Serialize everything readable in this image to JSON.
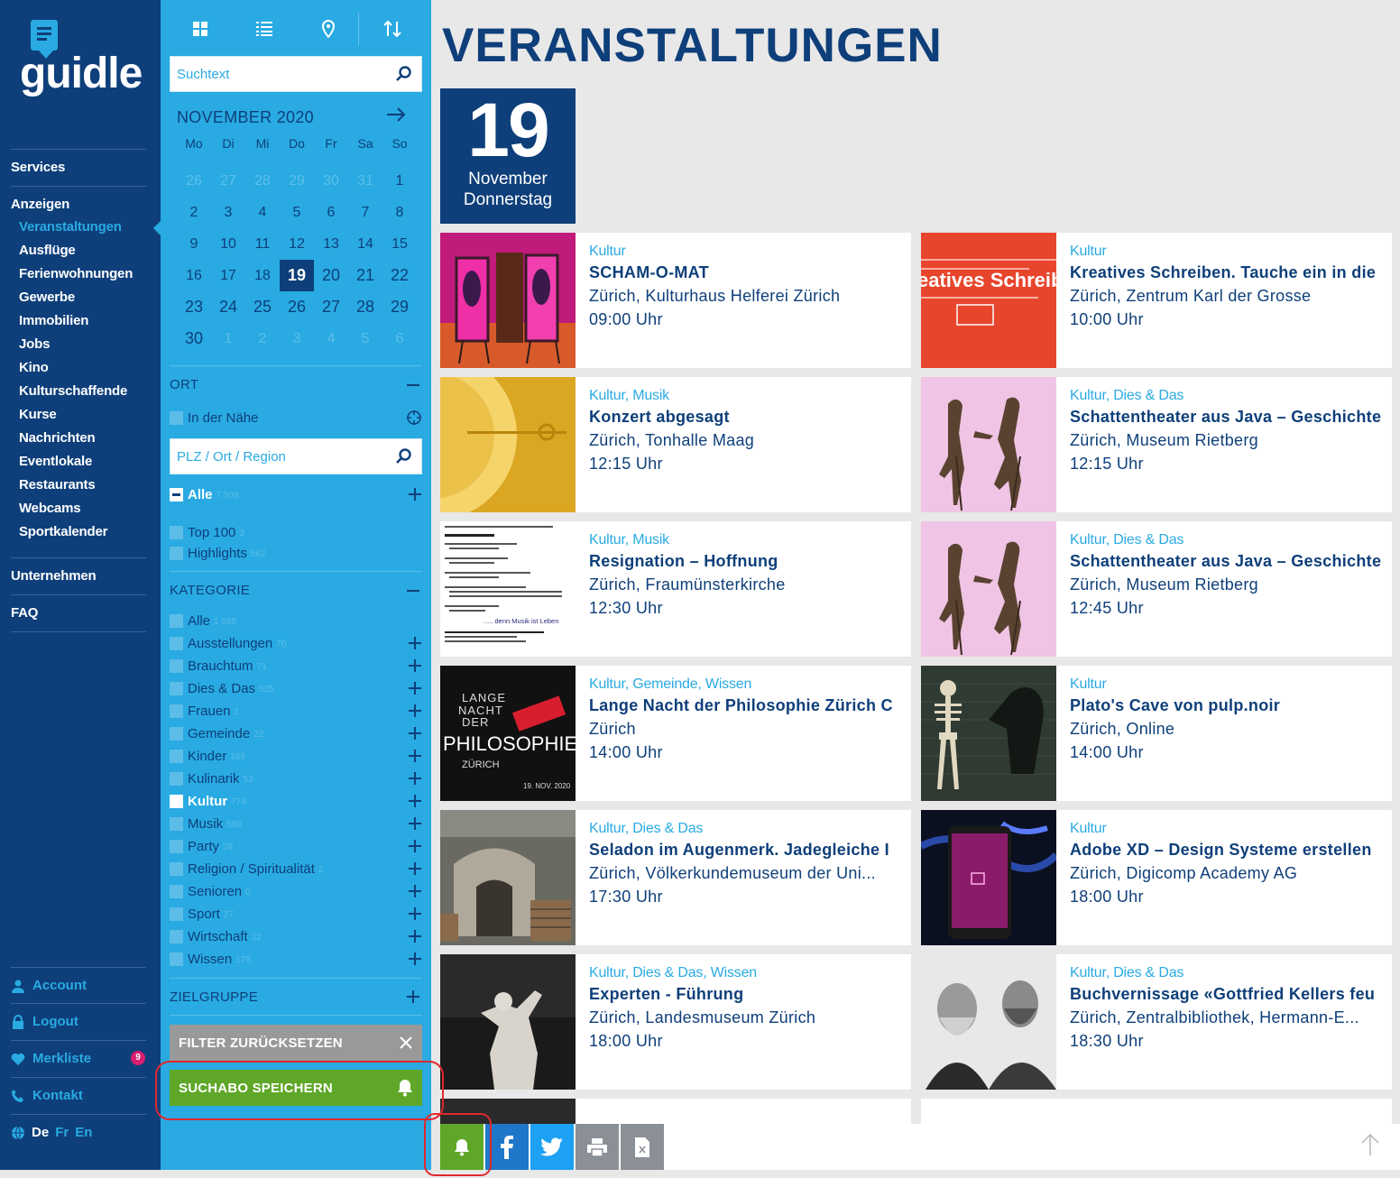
{
  "brand": {
    "name": "guidle"
  },
  "nav": {
    "items": [
      {
        "label": "Services",
        "level": 0
      },
      {
        "label": "Anzeigen",
        "level": 0
      },
      {
        "label": "Veranstaltungen",
        "level": 1,
        "active": true
      },
      {
        "label": "Ausflüge",
        "level": 1
      },
      {
        "label": "Ferienwohnungen",
        "level": 1
      },
      {
        "label": "Gewerbe",
        "level": 1
      },
      {
        "label": "Immobilien",
        "level": 1
      },
      {
        "label": "Jobs",
        "level": 1
      },
      {
        "label": "Kino",
        "level": 1
      },
      {
        "label": "Kulturschaffende",
        "level": 1
      },
      {
        "label": "Kurse",
        "level": 1
      },
      {
        "label": "Nachrichten",
        "level": 1
      },
      {
        "label": "Eventlokale",
        "level": 1
      },
      {
        "label": "Restaurants",
        "level": 1
      },
      {
        "label": "Webcams",
        "level": 1
      },
      {
        "label": "Sportkalender",
        "level": 1
      },
      {
        "label": "Unternehmen",
        "level": 0
      },
      {
        "label": "FAQ",
        "level": 0
      }
    ],
    "bottom": [
      {
        "label": "Account",
        "icon": "user-icon"
      },
      {
        "label": "Logout",
        "icon": "lock-icon"
      },
      {
        "label": "Merkliste",
        "icon": "heart-icon",
        "badge": "9"
      },
      {
        "label": "Kontakt",
        "icon": "phone-icon"
      }
    ],
    "languages": [
      "De",
      "Fr",
      "En"
    ]
  },
  "filter": {
    "search_placeholder": "Suchtext",
    "calendar": {
      "month": "NOVEMBER 2020",
      "weekdays": [
        "Mo",
        "Di",
        "Mi",
        "Do",
        "Fr",
        "Sa",
        "So"
      ],
      "weeks": [
        [
          "26",
          "27",
          "28",
          "29",
          "30",
          "31",
          "1"
        ],
        [
          "2",
          "3",
          "4",
          "5",
          "6",
          "7",
          "8"
        ],
        [
          "9",
          "10",
          "11",
          "12",
          "13",
          "14",
          "15"
        ],
        [
          "16",
          "17",
          "18",
          "19",
          "20",
          "21",
          "22"
        ],
        [
          "23",
          "24",
          "25",
          "26",
          "27",
          "28",
          "29"
        ],
        [
          "30",
          "1",
          "2",
          "3",
          "4",
          "5",
          "6"
        ]
      ],
      "selected": "19"
    },
    "ort": {
      "heading": "ORT",
      "near_label": "In der Nähe",
      "place_placeholder": "PLZ / Ort / Region",
      "all_label": "Alle",
      "all_count": "7 509",
      "options": [
        {
          "label": "Top 100",
          "count": "3"
        },
        {
          "label": "Highlights",
          "count": "562"
        }
      ]
    },
    "kategorie": {
      "heading": "KATEGORIE",
      "items": [
        {
          "label": "Alle",
          "count": "1 655",
          "plus": false
        },
        {
          "label": "Ausstellungen",
          "count": "70",
          "plus": true
        },
        {
          "label": "Brauchtum",
          "count": "71",
          "plus": true
        },
        {
          "label": "Dies & Das",
          "count": "525",
          "plus": true
        },
        {
          "label": "Frauen",
          "count": "1",
          "plus": true
        },
        {
          "label": "Gemeinde",
          "count": "22",
          "plus": true
        },
        {
          "label": "Kinder",
          "count": "169",
          "plus": true
        },
        {
          "label": "Kulinarik",
          "count": "53",
          "plus": true
        },
        {
          "label": "Kultur",
          "count": "774",
          "plus": true,
          "checked": true
        },
        {
          "label": "Musik",
          "count": "589",
          "plus": true
        },
        {
          "label": "Party",
          "count": "28",
          "plus": true
        },
        {
          "label": "Religion / Spiritualität",
          "count": "2",
          "plus": true
        },
        {
          "label": "Senioren",
          "count": "0",
          "plus": true
        },
        {
          "label": "Sport",
          "count": "27",
          "plus": true
        },
        {
          "label": "Wirtschaft",
          "count": "22",
          "plus": true
        },
        {
          "label": "Wissen",
          "count": "178",
          "plus": true
        }
      ]
    },
    "zielgruppe_heading": "ZIELGRUPPE",
    "reset_label": "FILTER ZURÜCKSETZEN",
    "save_label": "SUCHABO SPEICHERN"
  },
  "main": {
    "title": "VERANSTALTUNGEN",
    "date": {
      "day": "19",
      "month": "November",
      "weekday": "Donnerstag"
    },
    "events": [
      {
        "category": "Kultur",
        "title": "SCHAM-O-MAT",
        "location": "Zürich, Kulturhaus Helferei Zürich",
        "time": "09:00 Uhr",
        "thumb": "pink-installation"
      },
      {
        "category": "Kultur",
        "title": "Kreatives Schreiben. Tauche ein in die",
        "location": "Zürich, Zentrum Karl der Grosse",
        "time": "10:00 Uhr",
        "thumb": "red-poster",
        "thumb_text": "eatives Schreib"
      },
      {
        "category": "Kultur, Musik",
        "title": "Konzert abgesagt",
        "location": "Zürich, Tonhalle Maag",
        "time": "12:15 Uhr",
        "thumb": "gold-plate"
      },
      {
        "category": "Kultur, Dies & Das",
        "title": "Schattentheater aus Java – Geschichte",
        "location": "Zürich, Museum Rietberg",
        "time": "12:15 Uhr",
        "thumb": "puppets"
      },
      {
        "category": "Kultur, Musik",
        "title": "Resignation – Hoffnung",
        "location": "Zürich, Fraumünsterkirche",
        "time": "12:30 Uhr",
        "thumb": "program-sheet",
        "thumb_text": "..... denn Musik ist Leben"
      },
      {
        "category": "Kultur, Dies & Das",
        "title": "Schattentheater aus Java – Geschichte",
        "location": "Zürich, Museum Rietberg",
        "time": "12:45 Uhr",
        "thumb": "puppets"
      },
      {
        "category": "Kultur, Gemeinde, Wissen",
        "title": "Lange Nacht der Philosophie Zürich C",
        "location": "Zürich",
        "time": "14:00 Uhr",
        "thumb": "philosophie-poster",
        "thumb_text": "PHILOSOPHIE"
      },
      {
        "category": "Kultur",
        "title": "Plato's Cave von pulp.noir",
        "location": "Zürich, Online",
        "time": "14:00 Uhr",
        "thumb": "skeleton"
      },
      {
        "category": "Kultur, Dies & Das",
        "title": "Seladon im Augenmerk. Jadegleiche I",
        "location": "Zürich, Völkerkundemuseum der Uni...",
        "time": "17:30 Uhr",
        "thumb": "kiln"
      },
      {
        "category": "Kultur",
        "title": "Adobe XD – Design Systeme erstellen",
        "location": "Zürich, Digicomp Academy AG",
        "time": "18:00 Uhr",
        "thumb": "phone-xd"
      },
      {
        "category": "Kultur, Dies & Das, Wissen",
        "title": "Experten - Führung",
        "location": "Zürich, Landesmuseum Zürich",
        "time": "18:00 Uhr",
        "thumb": "statue"
      },
      {
        "category": "Kultur, Dies & Das",
        "title": "Buchvernissage «Gottfried Kellers feu",
        "location": "Zürich, Zentralbibliothek, Hermann-E...",
        "time": "18:30 Uhr",
        "thumb": "portraits"
      }
    ],
    "share_buttons": [
      {
        "name": "bell-icon",
        "color": "#5fa728"
      },
      {
        "name": "facebook-icon",
        "color": "#1f77c9"
      },
      {
        "name": "twitter-icon",
        "color": "#1da1f2"
      },
      {
        "name": "print-icon",
        "color": "#8a9096"
      },
      {
        "name": "excel-icon",
        "color": "#8a9096"
      }
    ]
  },
  "colors": {
    "navy": "#0e3f7a",
    "cyan": "#29aae2",
    "green": "#5fa728",
    "grey": "#999999"
  }
}
